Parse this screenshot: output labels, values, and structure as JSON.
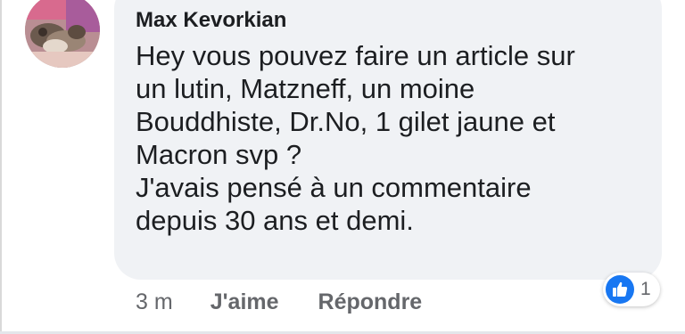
{
  "comment": {
    "author": "Max Kevorkian",
    "text_lines": [
      "Hey vous pouvez faire un article sur",
      "un lutin, Matzneff, un moine",
      "Bouddhiste, Dr.No, 1 gilet jaune et",
      "Macron svp ?",
      "J'avais pensé à un commentaire",
      "depuis 30 ans et demi."
    ],
    "timestamp": "3 m",
    "like_label": "J'aime",
    "reply_label": "Répondre",
    "reactions": {
      "icon": "thumbs-up-icon",
      "count": "1",
      "color": "#1877f2"
    }
  },
  "colors": {
    "bubble": "#f0f2f5",
    "text": "#1c1e21",
    "secondary_text": "#65676b"
  }
}
